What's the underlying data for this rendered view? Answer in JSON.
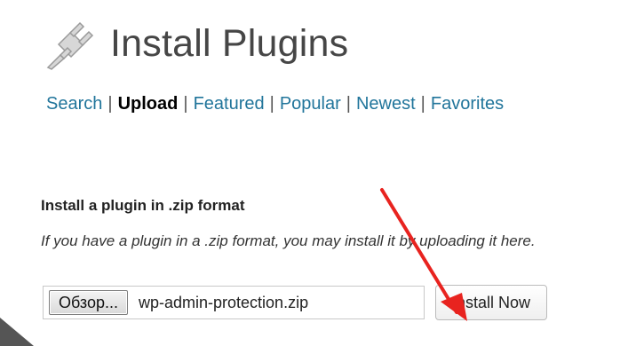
{
  "header": {
    "title": "Install Plugins",
    "icon": "plugin-icon"
  },
  "subnav": {
    "items": [
      {
        "label": "Search",
        "current": false
      },
      {
        "label": "Upload",
        "current": true
      },
      {
        "label": "Featured",
        "current": false
      },
      {
        "label": "Popular",
        "current": false
      },
      {
        "label": "Newest",
        "current": false
      },
      {
        "label": "Favorites",
        "current": false
      }
    ],
    "separator": "|"
  },
  "upload": {
    "section_title": "Install a plugin in .zip format",
    "description": "If you have a plugin in a .zip format, you may install it by uploading it here.",
    "browse_label": "Обзор...",
    "file_name": "wp-admin-protection.zip",
    "install_label": "Install Now"
  },
  "colors": {
    "link": "#21759b",
    "arrow": "#e8231f"
  },
  "annotation": {
    "icon": "red-arrow-icon"
  }
}
